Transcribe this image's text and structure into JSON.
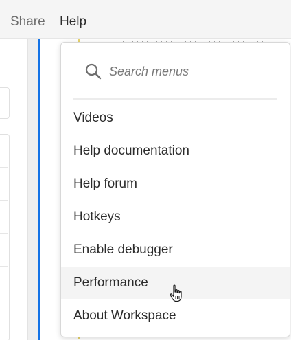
{
  "menubar": {
    "items": [
      {
        "label": "Share"
      },
      {
        "label": "Help"
      }
    ]
  },
  "help_menu": {
    "search": {
      "placeholder": "Search menus",
      "value": ""
    },
    "items": [
      {
        "label": "Videos"
      },
      {
        "label": "Help documentation"
      },
      {
        "label": "Help forum"
      },
      {
        "label": "Hotkeys"
      },
      {
        "label": "Enable debugger"
      },
      {
        "label": "Performance",
        "state": "hovered"
      },
      {
        "label": "About Workspace"
      }
    ]
  },
  "colors": {
    "accent": "#1473e6",
    "menu_text": "#2c2c2c",
    "muted_text": "#6e6e6e",
    "hover_bg": "#f4f4f4"
  },
  "icons": {
    "search": "search-icon",
    "cursor": "hand-pointer-icon"
  }
}
